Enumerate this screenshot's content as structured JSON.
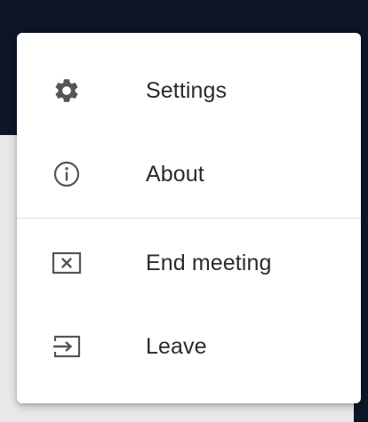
{
  "menu": {
    "items": [
      {
        "label": "Settings",
        "icon": "gear-icon"
      },
      {
        "label": "About",
        "icon": "info-icon"
      },
      {
        "label": "End meeting",
        "icon": "close-box-icon"
      },
      {
        "label": "Leave",
        "icon": "exit-icon"
      }
    ]
  },
  "colors": {
    "background_dark": "#0c1628",
    "menu_bg": "#ffffff",
    "text": "#2b2b2b",
    "icon": "#555555",
    "divider": "#dcdcdc"
  }
}
